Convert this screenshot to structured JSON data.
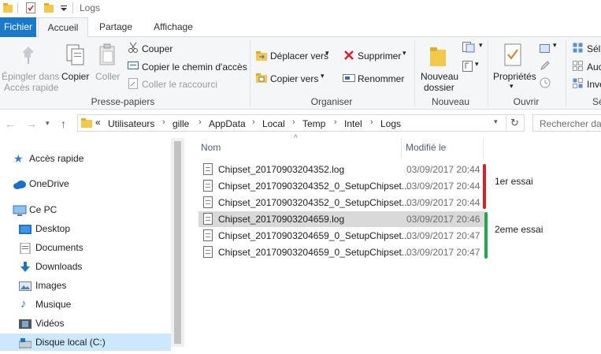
{
  "window": {
    "title": "Logs"
  },
  "tabs": [
    {
      "label": "Fichier"
    },
    {
      "label": "Accueil"
    },
    {
      "label": "Partage"
    },
    {
      "label": "Affichage"
    }
  ],
  "ribbon": {
    "pin_label_1": "Épingler dans",
    "pin_label_2": "Accès rapide",
    "copy": "Copier",
    "paste": "Coller",
    "cut": "Couper",
    "copy_path": "Copier le chemin d'accès",
    "paste_shortcut": "Coller le raccourci",
    "group_clipboard": "Presse-papiers",
    "move_to": "Déplacer vers",
    "copy_to": "Copier vers",
    "delete": "Supprimer",
    "rename": "Renommer",
    "group_organize": "Organiser",
    "new_folder_1": "Nouveau",
    "new_folder_2": "dossier",
    "group_new": "Nouveau",
    "properties": "Propriétés",
    "group_open": "Ouvrir",
    "select_all": "Sél",
    "select_none": "Auc",
    "invert": "Inve",
    "group_select": "Sé"
  },
  "address": {
    "prefix": "«",
    "crumbs": [
      "Utilisateurs",
      "gille",
      "AppData",
      "Local",
      "Temp",
      "Intel",
      "Logs"
    ],
    "search_placeholder": "Rechercher dan"
  },
  "nav": {
    "quick_access": "Accès rapide",
    "onedrive": "OneDrive",
    "this_pc": "Ce PC",
    "desktop": "Desktop",
    "documents": "Documents",
    "downloads": "Downloads",
    "images": "Images",
    "music": "Musique",
    "videos": "Vidéos",
    "local_disk": "Disque local (C:)"
  },
  "columns": {
    "name": "Nom",
    "modified": "Modifié le"
  },
  "files": [
    {
      "name": "Chipset_20170903204352.log",
      "date": "03/09/2017 20:44"
    },
    {
      "name": "Chipset_20170903204352_0_SetupChipset...",
      "date": "03/09/2017 20:44"
    },
    {
      "name": "Chipset_20170903204352_0_SetupChipset...",
      "date": "03/09/2017 20:44"
    },
    {
      "name": "Chipset_20170903204659.log",
      "date": "03/09/2017 20:46"
    },
    {
      "name": "Chipset_20170903204659_0_SetupChipset...",
      "date": "03/09/2017 20:47"
    },
    {
      "name": "Chipset_20170903204659_0_SetupChipset...",
      "date": "03/09/2017 20:47"
    }
  ],
  "annotations": {
    "first": "1er essai",
    "second": "2eme essai",
    "first_color": "#d9202a",
    "second_color": "#1faa4a"
  },
  "colors": {
    "file_tab": "#1979ca",
    "selection": "#cce8ff",
    "row_selected": "#d9d9d9"
  }
}
